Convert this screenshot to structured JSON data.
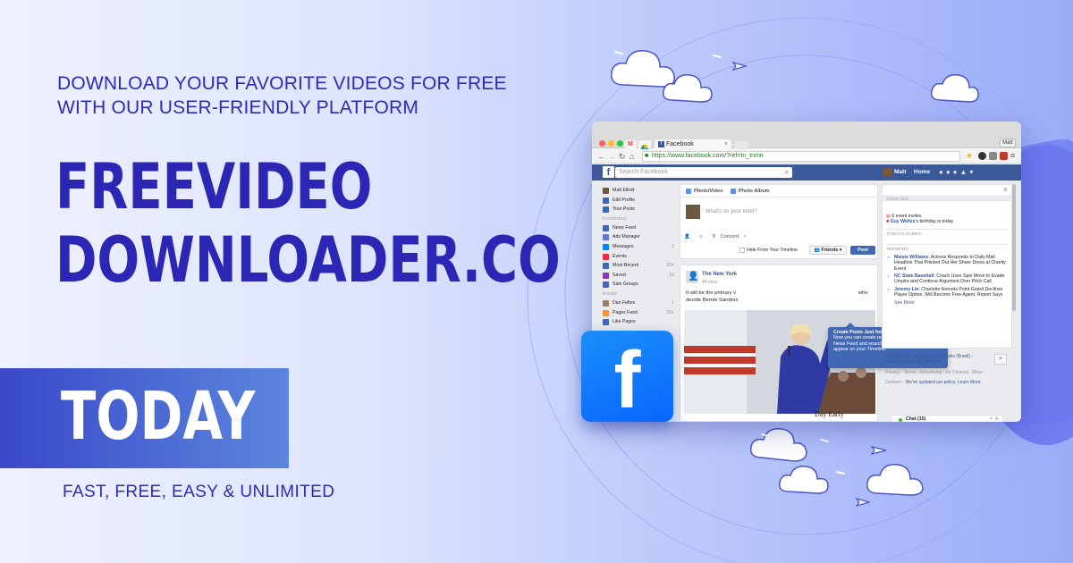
{
  "hero": {
    "subheadline_line1": "DOWNLOAD YOUR FAVORITE VIDEOS FOR FREE",
    "subheadline_line2": "WITH OUR USER-FRIENDLY PLATFORM",
    "title_line1": "FREEVIDEO",
    "title_line2": "DOWNLOADER.CO",
    "today": "TODAY",
    "tagline": "FAST, FREE, EASY & UNLIMITED"
  },
  "colors": {
    "accent": "#2c26b4",
    "band": "#4a6fd6",
    "facebook_blue": "#0866ff",
    "fb_bar": "#3b5998"
  },
  "fb_badge": {
    "glyph": "f",
    "icon": "facebook-logo-icon"
  },
  "browser": {
    "tab_gmail": "M",
    "tab_title": "Facebook",
    "tab_close": "×",
    "profile": "Matt",
    "url": "https://www.facebook.com/?ref=tn_tnmn",
    "search_placeholder": "Search Facebook",
    "user_name": "Matt",
    "home_label": "Home"
  },
  "left_nav": {
    "profile_items": [
      {
        "label": "Matt Elliott",
        "count": ""
      },
      {
        "label": "Edit Profile",
        "count": ""
      },
      {
        "label": "Your Posts",
        "count": ""
      }
    ],
    "favorites_header": "FAVORITES",
    "favorites": [
      {
        "label": "News Feed",
        "count": ""
      },
      {
        "label": "Ads Manager",
        "count": ""
      },
      {
        "label": "Messages",
        "count": "3"
      },
      {
        "label": "Events",
        "count": ""
      },
      {
        "label": "Most Recent",
        "count": "20+"
      },
      {
        "label": "Saved",
        "count": "16"
      },
      {
        "label": "Sale Groups",
        "count": ""
      }
    ],
    "pages_header": "PAGES",
    "pages": [
      {
        "label": "Dan Feltes",
        "count": "1"
      },
      {
        "label": "Pages Feed",
        "count": "20+"
      },
      {
        "label": "Like Pages",
        "count": ""
      }
    ]
  },
  "composer": {
    "tab_photo": "Photo/Video",
    "tab_album": "Photo Album",
    "placeholder": "What's on your mind?",
    "location": "Concord",
    "location_close": "×",
    "hide_timeline": "Hide From Your Timeline",
    "audience": "Friends",
    "post": "Post"
  },
  "tooltip": {
    "title": "Create Posts Just for News Feed",
    "body": "Now you can create posts that only show up in News Feed and search results. They won't appear on your Timeline.",
    "close": "×"
  },
  "feed_post": {
    "source": "The New York",
    "time": "44 mins",
    "text_line1": "It will be the primary v",
    "text_line2": "decide Bernie Sanders",
    "text_who": "who",
    "caption": "Day Early"
  },
  "right_col": {
    "ads_header": "YOUR ADS",
    "event_invites": "6 event invites",
    "birthday_name": "Guy Welles",
    "birthday_text": "'s birthday is today",
    "games_header": "TODAY'S GAMES",
    "trending_header": "TRENDING",
    "trends": [
      {
        "name": "Maisie Williams",
        "text": ": Actress Responds to Daily Mail Headline That Pointed Out Her Sheer Dress at Charity Event"
      },
      {
        "name": "NC State Baseball",
        "text": ": Coach Uses Spin Move to Evade Umpire and Continue Argument Over Pitch Call"
      },
      {
        "name": "Jeremy Lin",
        "text": ": Charlotte Hornets Point Guard Declines Player Option, Will Become Free Agent, Report Says"
      }
    ],
    "see_more": "See More",
    "languages": "English (US) · Español · Português (Brasil) · Français (France) · Deutsch",
    "add_lang": "+",
    "footer": "Privacy · Terms · Advertising · Ad Choices · More ·",
    "cookies_prefix": "Cookies · ",
    "cookies_text": "We've updated our policy.",
    "learn_more": "Learn More.",
    "chat": "Chat (15)"
  }
}
